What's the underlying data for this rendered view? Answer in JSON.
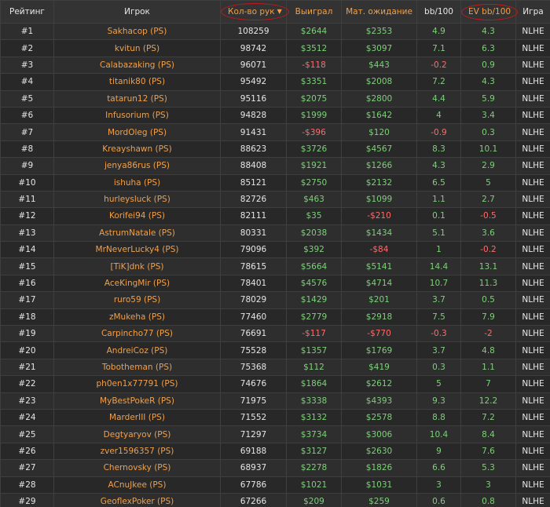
{
  "headers": {
    "rank": "Рейтинг",
    "player": "Игрок",
    "hands": "Кол-во рук",
    "won": "Выиграл",
    "expected": "Мат. ожидание",
    "bb100": "bb/100",
    "evbb100": "EV bb/100",
    "game": "Игра"
  },
  "sort_icon": "caret-down-icon",
  "colors": {
    "orange": "#f0a04b",
    "positive": "#7ed07a",
    "negative": "#ff6b6b",
    "highlight_circle": "#c8171e"
  },
  "rows": [
    {
      "rank": "#1",
      "player": "Sakhacop (PS)",
      "hands": "108259",
      "won": "$2644",
      "expected": "$2353",
      "bb100": "4.9",
      "evbb100": "4.3",
      "game": "NLHE"
    },
    {
      "rank": "#2",
      "player": "kvitun (PS)",
      "hands": "98742",
      "won": "$3512",
      "expected": "$3097",
      "bb100": "7.1",
      "evbb100": "6.3",
      "game": "NLHE"
    },
    {
      "rank": "#3",
      "player": "Calabazaking (PS)",
      "hands": "96071",
      "won": "-$118",
      "expected": "$443",
      "bb100": "-0.2",
      "evbb100": "0.9",
      "game": "NLHE"
    },
    {
      "rank": "#4",
      "player": "titanik80 (PS)",
      "hands": "95492",
      "won": "$3351",
      "expected": "$2008",
      "bb100": "7.2",
      "evbb100": "4.3",
      "game": "NLHE"
    },
    {
      "rank": "#5",
      "player": "tatarun12 (PS)",
      "hands": "95116",
      "won": "$2075",
      "expected": "$2800",
      "bb100": "4.4",
      "evbb100": "5.9",
      "game": "NLHE"
    },
    {
      "rank": "#6",
      "player": "Infusorium (PS)",
      "hands": "94828",
      "won": "$1999",
      "expected": "$1642",
      "bb100": "4",
      "evbb100": "3.4",
      "game": "NLHE"
    },
    {
      "rank": "#7",
      "player": "MordOleg (PS)",
      "hands": "91431",
      "won": "-$396",
      "expected": "$120",
      "bb100": "-0.9",
      "evbb100": "0.3",
      "game": "NLHE"
    },
    {
      "rank": "#8",
      "player": "Kreayshawn (PS)",
      "hands": "88623",
      "won": "$3726",
      "expected": "$4567",
      "bb100": "8.3",
      "evbb100": "10.1",
      "game": "NLHE"
    },
    {
      "rank": "#9",
      "player": "jenya86rus (PS)",
      "hands": "88408",
      "won": "$1921",
      "expected": "$1266",
      "bb100": "4.3",
      "evbb100": "2.9",
      "game": "NLHE"
    },
    {
      "rank": "#10",
      "player": "ishuha (PS)",
      "hands": "85121",
      "won": "$2750",
      "expected": "$2132",
      "bb100": "6.5",
      "evbb100": "5",
      "game": "NLHE"
    },
    {
      "rank": "#11",
      "player": "hurleysluck (PS)",
      "hands": "82726",
      "won": "$463",
      "expected": "$1099",
      "bb100": "1.1",
      "evbb100": "2.7",
      "game": "NLHE"
    },
    {
      "rank": "#12",
      "player": "Korifei94 (PS)",
      "hands": "82111",
      "won": "$35",
      "expected": "-$210",
      "bb100": "0.1",
      "evbb100": "-0.5",
      "game": "NLHE"
    },
    {
      "rank": "#13",
      "player": "AstrumNatale (PS)",
      "hands": "80331",
      "won": "$2038",
      "expected": "$1434",
      "bb100": "5.1",
      "evbb100": "3.6",
      "game": "NLHE"
    },
    {
      "rank": "#14",
      "player": "MrNeverLucky4 (PS)",
      "hands": "79096",
      "won": "$392",
      "expected": "-$84",
      "bb100": "1",
      "evbb100": "-0.2",
      "game": "NLHE"
    },
    {
      "rank": "#15",
      "player": "[TiK]dnk (PS)",
      "hands": "78615",
      "won": "$5664",
      "expected": "$5141",
      "bb100": "14.4",
      "evbb100": "13.1",
      "game": "NLHE"
    },
    {
      "rank": "#16",
      "player": "AceKingMir (PS)",
      "hands": "78401",
      "won": "$4576",
      "expected": "$4714",
      "bb100": "10.7",
      "evbb100": "11.3",
      "game": "NLHE"
    },
    {
      "rank": "#17",
      "player": "ruro59 (PS)",
      "hands": "78029",
      "won": "$1429",
      "expected": "$201",
      "bb100": "3.7",
      "evbb100": "0.5",
      "game": "NLHE"
    },
    {
      "rank": "#18",
      "player": "zMukeha (PS)",
      "hands": "77460",
      "won": "$2779",
      "expected": "$2918",
      "bb100": "7.5",
      "evbb100": "7.9",
      "game": "NLHE"
    },
    {
      "rank": "#19",
      "player": "Carpincho77 (PS)",
      "hands": "76691",
      "won": "-$117",
      "expected": "-$770",
      "bb100": "-0.3",
      "evbb100": "-2",
      "game": "NLHE"
    },
    {
      "rank": "#20",
      "player": "AndreiCoz (PS)",
      "hands": "75528",
      "won": "$1357",
      "expected": "$1769",
      "bb100": "3.7",
      "evbb100": "4.8",
      "game": "NLHE"
    },
    {
      "rank": "#21",
      "player": "Tobotheman (PS)",
      "hands": "75368",
      "won": "$112",
      "expected": "$419",
      "bb100": "0.3",
      "evbb100": "1.1",
      "game": "NLHE"
    },
    {
      "rank": "#22",
      "player": "ph0en1x77791 (PS)",
      "hands": "74676",
      "won": "$1864",
      "expected": "$2612",
      "bb100": "5",
      "evbb100": "7",
      "game": "NLHE"
    },
    {
      "rank": "#23",
      "player": "MyBestPokeR (PS)",
      "hands": "71975",
      "won": "$3338",
      "expected": "$4393",
      "bb100": "9.3",
      "evbb100": "12.2",
      "game": "NLHE"
    },
    {
      "rank": "#24",
      "player": "MarderIII (PS)",
      "hands": "71552",
      "won": "$3132",
      "expected": "$2578",
      "bb100": "8.8",
      "evbb100": "7.2",
      "game": "NLHE"
    },
    {
      "rank": "#25",
      "player": "Degtyaryov (PS)",
      "hands": "71297",
      "won": "$3734",
      "expected": "$3006",
      "bb100": "10.4",
      "evbb100": "8.4",
      "game": "NLHE"
    },
    {
      "rank": "#26",
      "player": "zver1596357 (PS)",
      "hands": "69188",
      "won": "$3127",
      "expected": "$2630",
      "bb100": "9",
      "evbb100": "7.6",
      "game": "NLHE"
    },
    {
      "rank": "#27",
      "player": "Chernovsky (PS)",
      "hands": "68937",
      "won": "$2278",
      "expected": "$1826",
      "bb100": "6.6",
      "evbb100": "5.3",
      "game": "NLHE"
    },
    {
      "rank": "#28",
      "player": "ACnuJkee (PS)",
      "hands": "67786",
      "won": "$1021",
      "expected": "$1031",
      "bb100": "3",
      "evbb100": "3",
      "game": "NLHE"
    },
    {
      "rank": "#29",
      "player": "GeoflexPoker (PS)",
      "hands": "67266",
      "won": "$209",
      "expected": "$259",
      "bb100": "0.6",
      "evbb100": "0.8",
      "game": "NLHE"
    }
  ]
}
